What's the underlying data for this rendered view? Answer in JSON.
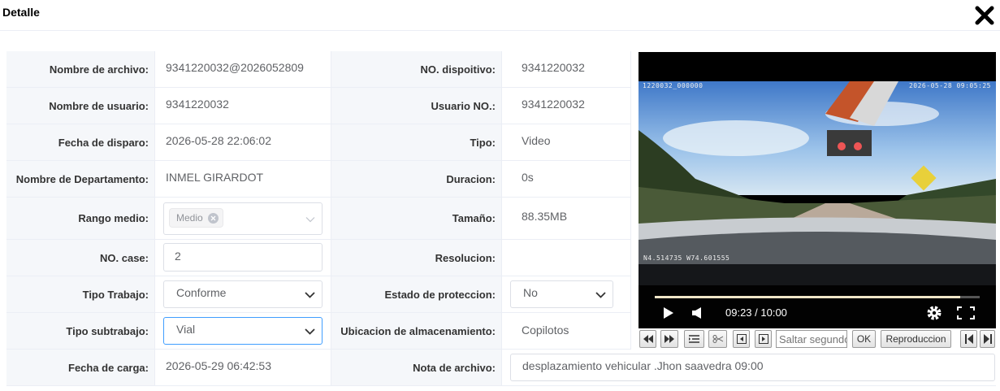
{
  "dialog": {
    "title": "Detalle",
    "close_icon": "close-icon"
  },
  "rows": {
    "r1": {
      "l1": "Nombre de archivo:",
      "v1": "9341220032@2026052809",
      "l2": "NO. dispoitivo:",
      "v2": "9341220032"
    },
    "r2": {
      "l1": "Nombre de usuario:",
      "v1": "9341220032",
      "l2": "Usuario NO.:",
      "v2": "9341220032"
    },
    "r3": {
      "l1": "Fecha de disparo:",
      "v1": "2026-05-28 22:06:02",
      "l2": "Tipo:",
      "v2": "Video"
    },
    "r4": {
      "l1": "Nombre de Departamento:",
      "v1": "INMEL GIRARDOT",
      "l2": "Duracion:",
      "v2": "0s"
    },
    "r5": {
      "l1": "Rango medio:",
      "tag": "Medio",
      "l2": "Tamaño:",
      "v2": "88.35MB"
    },
    "r6": {
      "l1": "NO. case:",
      "input_value": "2",
      "l2": "Resolucion:",
      "v2": ""
    },
    "r7": {
      "l1": "Tipo Trabajo:",
      "select_value": "Conforme",
      "l2": "Estado de proteccion:",
      "select2_value": "No"
    },
    "r8": {
      "l1": "Tipo subtrabajo:",
      "select_value": "Vial",
      "l2": "Ubicacion de almacenamiento:",
      "v2": "Copilotos"
    },
    "r9": {
      "l1": "Fecha de carga:",
      "v1": "2026-05-29 06:42:53",
      "l2": "Nota de archivo:",
      "note_value": "desplazamiento vehicular .Jhon saavedra 09:00"
    }
  },
  "video": {
    "osd_top_left": "1220032_000000",
    "osd_top_right": "2026-05-28 09:05:25",
    "osd_gps": "N4.514735 W74.601555",
    "time_display": "09:23 / 10:00",
    "progress_fraction": 0.94
  },
  "toolbar": {
    "skip_placeholder": "Saltar segundo",
    "ok_label": "OK",
    "playback_label": "Reproduccion"
  },
  "colors": {
    "label_bg": "#f5f7fa",
    "border": "#ebeef5",
    "focus": "#409eff"
  }
}
